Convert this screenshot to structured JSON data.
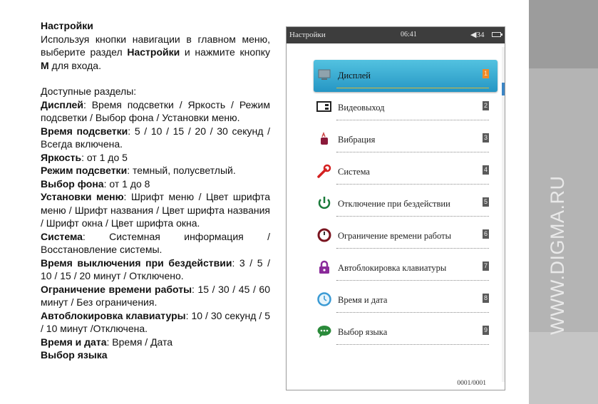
{
  "manual": {
    "heading": "Настройки",
    "intro_pre": "Используя кнопки навигации в главном меню, выберите раздел ",
    "intro_bold": "Настройки",
    "intro_mid": " и нажмите кнопку ",
    "intro_key": "M",
    "intro_post": " для входа.",
    "sections_title": "Доступные разделы:",
    "sections": [
      {
        "name": "Дисплей",
        "desc": ": Время подсветки / Яркость / Режим подсветки / Выбор фона / Установки меню."
      },
      {
        "name": "Время подсветки",
        "desc": ": 5 / 10 / 15 / 20 / 30 секунд / Всегда включена."
      },
      {
        "name": "Яркость",
        "desc": ": от 1 до 5"
      },
      {
        "name": "Режим подсветки",
        "desc": ": темный, полусветлый."
      },
      {
        "name": "Выбор фона",
        "desc": ": от 1 до 8"
      },
      {
        "name": "Установки меню",
        "desc": ": Шрифт меню / Цвет шрифта меню / Шрифт названия / Цвет шрифта названия / Шрифт окна / Цвет шрифта окна."
      },
      {
        "name": "Система",
        "desc": ": Системная информация / Восстановление системы."
      },
      {
        "name": "Время выключения при бездействии",
        "desc": ": 3 / 5 / 10 / 15 / 20 минут / Отключено."
      },
      {
        "name": "Ограничение времени работы",
        "desc": ": 15 / 30 / 45 / 60 минут / Без ограничения."
      },
      {
        "name": "Автоблокировка клавиатуры",
        "desc": ": 10 / 30 секунд / 5 / 10 минут /Отключена."
      },
      {
        "name": "Время и дата",
        "desc": ": Время / Дата"
      },
      {
        "name": "Выбор языка",
        "desc": ""
      }
    ]
  },
  "screen": {
    "status": {
      "title": "Настройки",
      "time": "06:41",
      "volume": "34"
    },
    "menu": [
      {
        "label": "Дисплей",
        "num": "1",
        "icon": "monitor-icon"
      },
      {
        "label": "Видеовыход",
        "num": "2",
        "icon": "video-out-icon"
      },
      {
        "label": "Вибрация",
        "num": "3",
        "icon": "vibration-icon"
      },
      {
        "label": "Система",
        "num": "4",
        "icon": "wrench-icon"
      },
      {
        "label": "Отключение при бездействии",
        "num": "5",
        "icon": "power-icon"
      },
      {
        "label": "Ограничение времени работы",
        "num": "6",
        "icon": "timer-limit-icon"
      },
      {
        "label": "Автоблокировка клавиатуры",
        "num": "7",
        "icon": "lock-icon"
      },
      {
        "label": "Время и дата",
        "num": "8",
        "icon": "clock-icon"
      },
      {
        "label": "Выбор языка",
        "num": "9",
        "icon": "speech-bubble-icon"
      }
    ],
    "page_count": "0001/0001"
  },
  "watermark": "WWW.DIGMA.RU",
  "colors": {
    "highlight": "#2596c4",
    "accent_orange": "#f08a28",
    "band": "#b4b4b4"
  }
}
